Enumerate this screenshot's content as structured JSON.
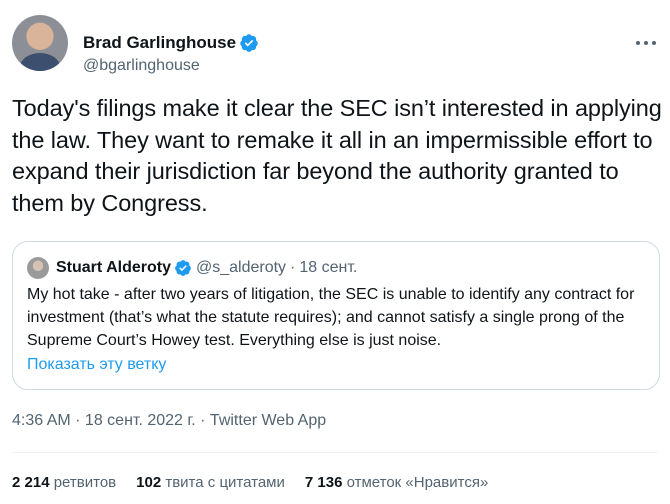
{
  "author": {
    "display_name": "Brad Garlinghouse",
    "handle": "@bgarlinghouse",
    "verified": true
  },
  "tweet": {
    "text": "Today's filings make it clear the SEC isn’t interested in applying the law. They want to remake it all in an impermissible effort to expand their jurisdiction far beyond the authority granted to them by Congress."
  },
  "quote": {
    "display_name": "Stuart Alderoty",
    "handle": "@s_alderoty",
    "separator": "·",
    "date": "18 сент.",
    "verified": true,
    "text": "My hot take - after two years of litigation, the SEC is unable to identify any contract for investment (that’s what the statute requires); and cannot satisfy a single prong of the Supreme Court’s Howey test. Everything else is just noise.",
    "show_thread": "Показать эту ветку"
  },
  "meta": {
    "timestamp": "4:36 AM · 18 сент. 2022 г. · Twitter Web App"
  },
  "stats": [
    {
      "value": "2 214",
      "label": "ретвитов"
    },
    {
      "value": "102",
      "label": "твита с цитатами"
    },
    {
      "value": "7 136",
      "label": "отметок «Нравится»"
    }
  ],
  "colors": {
    "accent": "#1d9bf0",
    "text": "#0f1419",
    "secondary": "#536471",
    "border": "#cfd9de"
  },
  "icons": {
    "verified": "verified-badge-icon",
    "more": "more-options-icon"
  }
}
